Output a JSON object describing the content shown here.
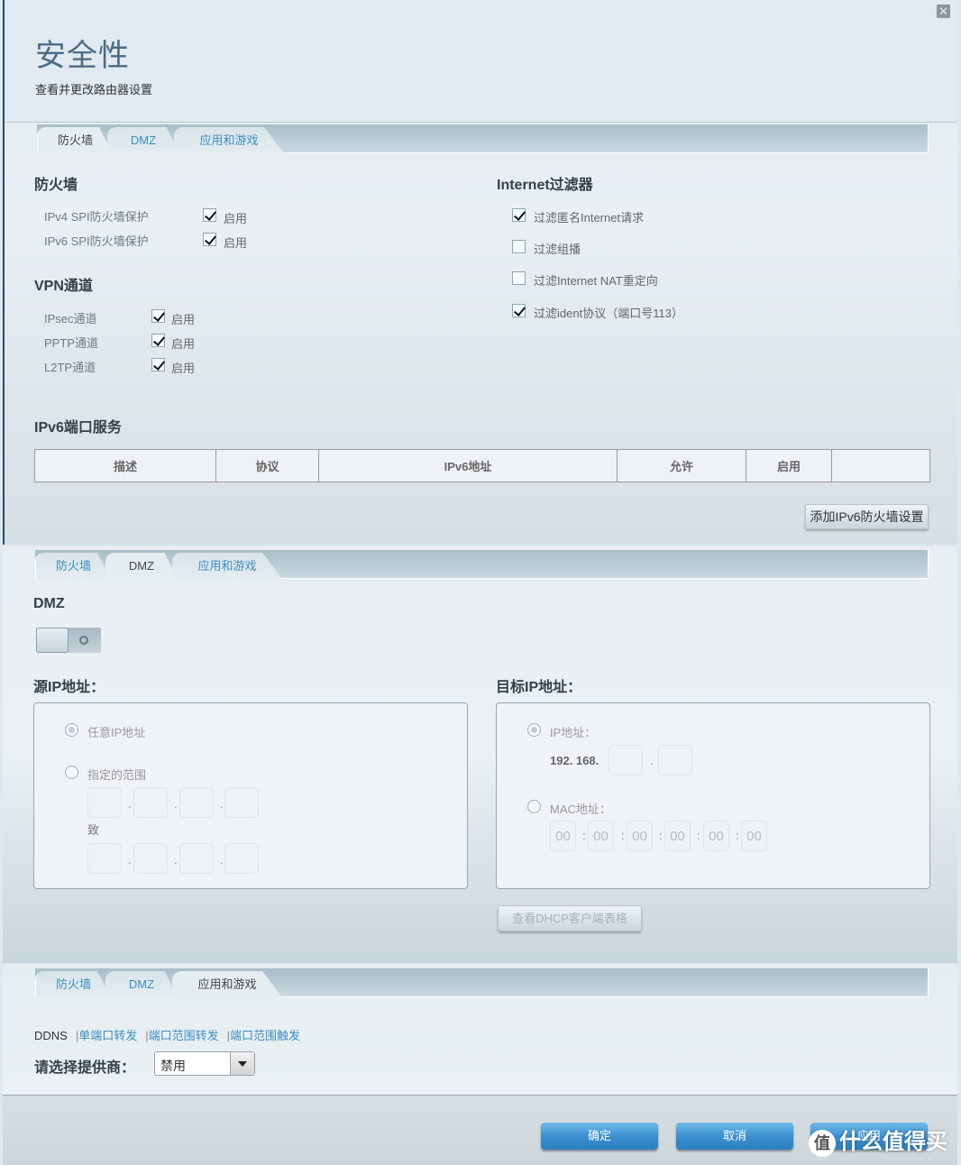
{
  "header": {
    "title": "安全性",
    "subtitle": "查看并更改路由器设置",
    "close_icon": "close-icon"
  },
  "tabs": [
    "防火墙",
    "DMZ",
    "应用和游戏"
  ],
  "firewall": {
    "active_tab": "防火墙",
    "firewall_section": {
      "title": "防火墙",
      "items": [
        {
          "label": "IPv4 SPI防火墙保护",
          "checkbox_label": "启用",
          "checked": true
        },
        {
          "label": "IPv6 SPI防火墙保护",
          "checkbox_label": "启用",
          "checked": true
        }
      ]
    },
    "vpn_section": {
      "title": "VPN通道",
      "items": [
        {
          "label": "IPsec通道",
          "checkbox_label": "启用",
          "checked": true
        },
        {
          "label": "PPTP通道",
          "checkbox_label": "启用",
          "checked": true
        },
        {
          "label": "L2TP通道",
          "checkbox_label": "启用",
          "checked": true
        }
      ]
    },
    "internet_filter": {
      "title": "Internet过滤器",
      "items": [
        {
          "label": "过滤匿名Internet请求",
          "checked": true
        },
        {
          "label": "过滤组播",
          "checked": false
        },
        {
          "label": "过滤Internet NAT重定向",
          "checked": false
        },
        {
          "label": "过滤ident协议（端口号113）",
          "checked": true
        }
      ]
    },
    "ipv6_services": {
      "title": "IPv6端口服务",
      "columns": [
        "描述",
        "协议",
        "IPv6地址",
        "允许",
        "启用",
        ""
      ],
      "rows": []
    },
    "add_button": "添加IPv6防火墙设置"
  },
  "dmz": {
    "active_tab": "DMZ",
    "title": "DMZ",
    "toggle_on": false,
    "source": {
      "title": "源IP地址：",
      "option_any": "任意IP地址",
      "option_range": "指定的范围",
      "to_label": "致",
      "selected": "any"
    },
    "destination": {
      "title": "目标IP地址：",
      "option_ip": "IP地址：",
      "ip_prefix": "192. 168.",
      "option_mac": "MAC地址：",
      "mac_values": [
        "00",
        "00",
        "00",
        "00",
        "00",
        "00"
      ],
      "selected": "ip"
    },
    "dhcp_button": "查看DHCP客户端表格"
  },
  "apps": {
    "active_tab": "应用和游戏",
    "subnav": [
      "DDNS",
      "单端口转发",
      "端口范围转发",
      "端口范围触发"
    ],
    "provider_label": "请选择提供商：",
    "provider_value": "禁用"
  },
  "footer": {
    "ok": "确定",
    "cancel": "取消",
    "apply": "应用"
  },
  "watermark": {
    "badge": "值",
    "text": "什么值得买"
  }
}
